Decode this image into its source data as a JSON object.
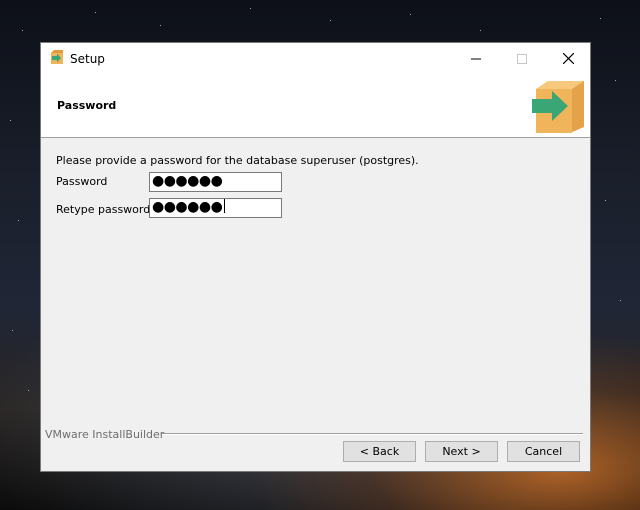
{
  "window": {
    "title": "Setup",
    "app_icon": "installer-box-icon",
    "controls": {
      "minimize": "minimize-icon",
      "maximize": "maximize-icon",
      "close": "close-icon"
    }
  },
  "header": {
    "title": "Password",
    "logo_icon": "installer-box-arrow-icon"
  },
  "body": {
    "description": "Please provide a password for the database superuser (postgres).",
    "password_label": "Password",
    "password_value": "●●●●●●",
    "retype_label": "Retype password",
    "retype_value": "●●●●●●"
  },
  "footer": {
    "brand": "VMware InstallBuilder",
    "back_label": "< Back",
    "next_label": "Next >",
    "cancel_label": "Cancel"
  },
  "colors": {
    "window_bg": "#f0f0f0",
    "header_bg": "#ffffff",
    "logo_orange": "#f0b45a",
    "logo_green": "#3aa676"
  }
}
